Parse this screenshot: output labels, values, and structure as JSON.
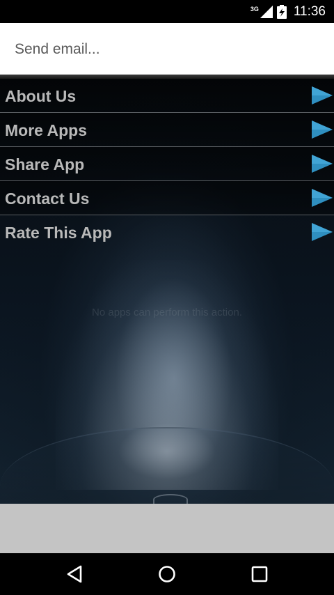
{
  "status_bar": {
    "network_type": "3G",
    "time": "11:36"
  },
  "dialog": {
    "title": "Send email..."
  },
  "menu": {
    "items": [
      {
        "label": "About Us"
      },
      {
        "label": "More Apps"
      },
      {
        "label": "Share App"
      },
      {
        "label": "Contact Us"
      },
      {
        "label": "Rate This App"
      }
    ],
    "arrow_color": "#2f8fc0"
  },
  "background_message": "No apps can perform this action.",
  "nav_bar": {
    "icons": [
      "back-icon",
      "home-icon",
      "recents-icon"
    ]
  }
}
